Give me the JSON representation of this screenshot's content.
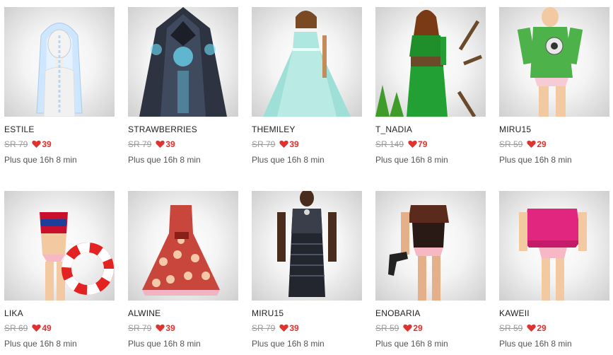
{
  "items": [
    {
      "name": "ESTILE",
      "old_price": "SR 79",
      "new_price": "39",
      "timer": "Plus que 16h 8 min",
      "image": "white-braided-hair-avatar"
    },
    {
      "name": "STRAWBERRIES",
      "old_price": "SR 79",
      "new_price": "39",
      "timer": "Plus que 16h 8 min",
      "image": "dark-armored-robe-avatar"
    },
    {
      "name": "THEMILEY",
      "old_price": "SR 79",
      "new_price": "39",
      "timer": "Plus que 16h 8 min",
      "image": "mint-gown-avatar"
    },
    {
      "name": "T_NADIA",
      "old_price": "SR 149",
      "new_price": "79",
      "timer": "Plus que 16h 8 min",
      "image": "green-forest-outfit-avatar"
    },
    {
      "name": "MIRU15",
      "old_price": "SR 59",
      "new_price": "29",
      "timer": "Plus que 16h 8 min",
      "image": "green-sweater-avatar"
    },
    {
      "name": "LIKA",
      "old_price": "SR 69",
      "new_price": "49",
      "timer": "Plus que 16h 8 min",
      "image": "sailor-swimsuit-lifebuoy-avatar"
    },
    {
      "name": "ALWINE",
      "old_price": "SR 79",
      "new_price": "39",
      "timer": "Plus que 16h 8 min",
      "image": "red-polka-dress-avatar"
    },
    {
      "name": "MIRU15",
      "old_price": "SR 79",
      "new_price": "39",
      "timer": "Plus que 16h 8 min",
      "image": "black-dress-avatar"
    },
    {
      "name": "ENOBARIA",
      "old_price": "SR 59",
      "new_price": "29",
      "timer": "Plus que 16h 8 min",
      "image": "leather-outfit-gun-avatar"
    },
    {
      "name": "KAWEII",
      "old_price": "SR 59",
      "new_price": "29",
      "timer": "Plus que 16h 8 min",
      "image": "pink-ruffle-top-avatar"
    }
  ],
  "colors": {
    "sale": "#e0322f",
    "old": "#9a9a9a",
    "heart": "#e0322f"
  }
}
